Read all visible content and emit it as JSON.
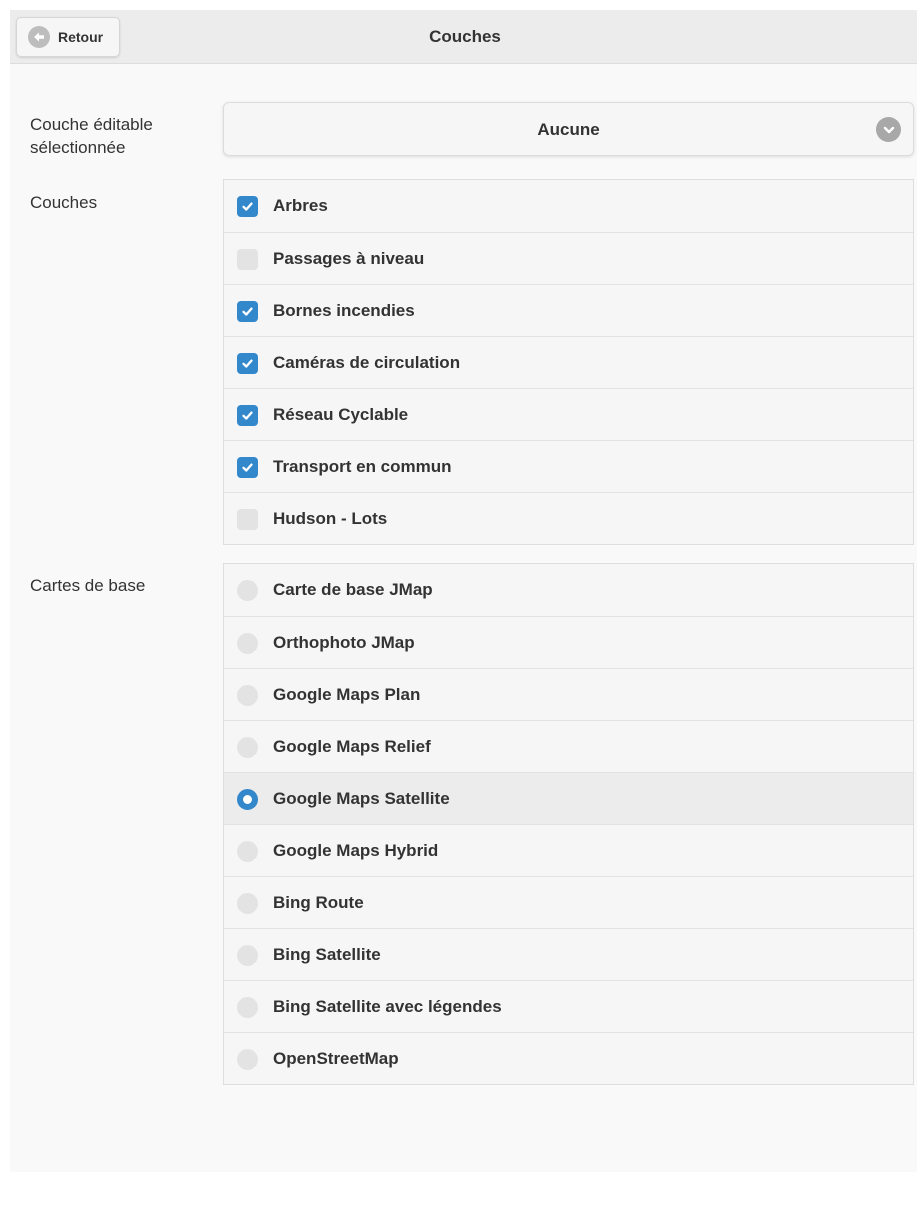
{
  "header": {
    "back_label": "Retour",
    "title": "Couches"
  },
  "editable_layer": {
    "label": "Couche éditable sélectionnée",
    "selected": "Aucune"
  },
  "layers": {
    "label": "Couches",
    "items": [
      {
        "label": "Arbres",
        "checked": true
      },
      {
        "label": "Passages à niveau",
        "checked": false
      },
      {
        "label": "Bornes incendies",
        "checked": true
      },
      {
        "label": "Caméras de circulation",
        "checked": true
      },
      {
        "label": "Réseau Cyclable",
        "checked": true
      },
      {
        "label": "Transport en commun",
        "checked": true
      },
      {
        "label": "Hudson - Lots",
        "checked": false
      }
    ]
  },
  "basemaps": {
    "label": "Cartes de base",
    "selected_index": 4,
    "items": [
      {
        "label": "Carte de base JMap"
      },
      {
        "label": "Orthophoto JMap"
      },
      {
        "label": "Google Maps Plan"
      },
      {
        "label": "Google Maps Relief"
      },
      {
        "label": "Google Maps Satellite"
      },
      {
        "label": "Google Maps Hybrid"
      },
      {
        "label": "Bing Route"
      },
      {
        "label": "Bing Satellite"
      },
      {
        "label": "Bing Satellite avec légendes"
      },
      {
        "label": "OpenStreetMap"
      }
    ]
  },
  "colors": {
    "accent": "#3388cc",
    "header_bg": "#ececec",
    "page_bg": "#f9f9f9"
  }
}
